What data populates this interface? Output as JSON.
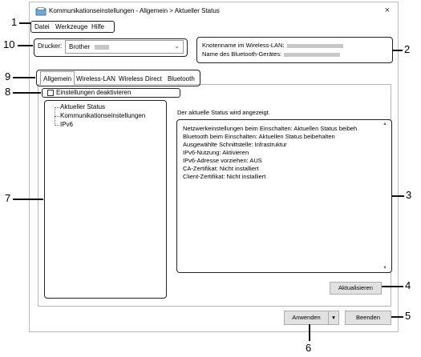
{
  "window": {
    "title": "Kommunikationseinstellungen - Allgemein > Aktueller Status",
    "close_glyph": "×"
  },
  "menu": [
    {
      "label": "Datei"
    },
    {
      "label": "Werkzeuge"
    },
    {
      "label": "Hilfe"
    }
  ],
  "printer": {
    "label": "Drucker:",
    "value": "Brother"
  },
  "node_info": {
    "wlan_label": "Knotenname im Wireless-LAN:",
    "bt_label": "Name des Bluetooth-Gerätes:"
  },
  "tabs": [
    {
      "label": "Allgemein",
      "active": true
    },
    {
      "label": "Wireless-LAN"
    },
    {
      "label": "Wireless Direct"
    },
    {
      "label": "Bluetooth"
    }
  ],
  "disable_settings": {
    "label": "Einstellungen deaktivieren",
    "checked": false
  },
  "tree": [
    "Aktueller Status",
    "Kommunikationseinstellungen",
    "IPv6"
  ],
  "status": {
    "heading": "Der aktuelle Status wird angezeigt.",
    "lines": [
      "Netzwerkeinstellungen beim Einschalten: Aktuellen Status beibeh",
      "Bluetooth beim Einschalten: Aktuellen Status beibehalten",
      "Ausgewählte Schnittstelle: Infrastruktur",
      "IPv6-Nutzung: Aktivieren",
      "IPv6-Adresse vorziehen: AUS",
      "CA-Zertifikat: Nicht installiert",
      "Client-Zertifikat: Nicht installiert"
    ]
  },
  "buttons": {
    "refresh": "Aktualisieren",
    "apply": "Anwenden",
    "close": "Beenden"
  },
  "callouts": [
    "1",
    "2",
    "3",
    "4",
    "5",
    "6",
    "7",
    "8",
    "9",
    "10"
  ]
}
